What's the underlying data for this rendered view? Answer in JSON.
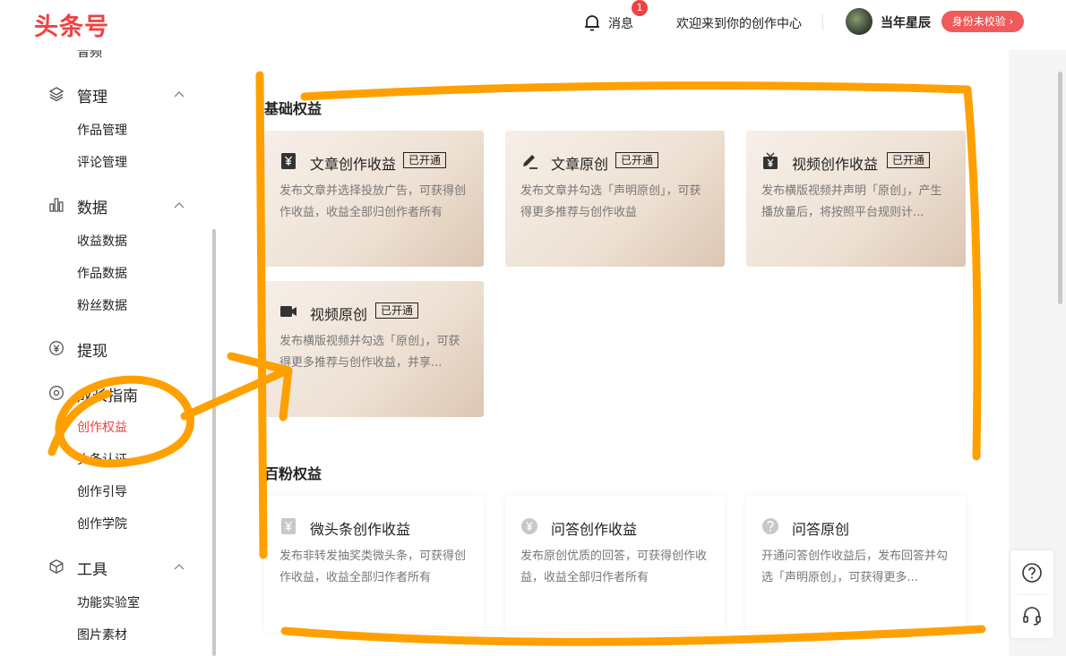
{
  "header": {
    "logo": "头条号",
    "messages_label": "消息",
    "messages_badge": "1",
    "welcome": "欢迎来到你的创作中心",
    "username": "当年星辰",
    "verify_label": "身份未校验 ›"
  },
  "sidebar": {
    "partial_top": "音频",
    "sections": [
      {
        "label": "管理",
        "icon": "layers-icon",
        "items": [
          "作品管理",
          "评论管理"
        ]
      },
      {
        "label": "数据",
        "icon": "bar-chart-icon",
        "items": [
          "收益数据",
          "作品数据",
          "粉丝数据"
        ]
      },
      {
        "label": "提现",
        "icon": "yen-circle-icon",
        "items": []
      },
      {
        "label": "成长指南",
        "icon": "compass-icon",
        "items": [
          "创作权益",
          "头条认证",
          "创作引导",
          "创作学院"
        ]
      },
      {
        "label": "工具",
        "icon": "cube-icon",
        "items": [
          "功能实验室",
          "图片素材"
        ]
      }
    ],
    "active_item": "创作权益"
  },
  "main": {
    "basic_title": "基础权益",
    "basic_cards": [
      {
        "title": "文章创作收益",
        "tag": "已开通",
        "icon": "yen-doc-icon",
        "desc": "发布文章并选择投放广告，可获得创作收益，收益全部归创作者所有"
      },
      {
        "title": "文章原创",
        "tag": "已开通",
        "icon": "pen-icon",
        "desc": "发布文章并勾选「声明原创」，可获得更多推荐与创作收益"
      },
      {
        "title": "视频创作收益",
        "tag": "已开通",
        "icon": "tv-yen-icon",
        "desc": "发布横版视频并声明「原创」，产生播放量后，将按照平台规则计..."
      },
      {
        "title": "视频原创",
        "tag": "已开通",
        "icon": "video-camera-icon",
        "desc": "发布横版视频并勾选「原创」，可获得更多推荐与创作收益，并享..."
      }
    ],
    "fans_title": "百粉权益",
    "fans_cards": [
      {
        "title": "微头条创作收益",
        "icon": "yen-doc-icon",
        "desc": "发布非转发抽奖类微头条，可获得创作收益，收益全部归作者所有"
      },
      {
        "title": "问答创作收益",
        "icon": "yen-circle-icon",
        "desc": "发布原创优质的回答，可获得创作收益，收益全部归作者所有"
      },
      {
        "title": "问答原创",
        "icon": "question-circle-icon",
        "desc": "开通问答创作收益后，发布回答并勾选「声明原创」，可获得更多..."
      }
    ]
  },
  "floating": {
    "help_icon": "question-icon",
    "service_icon": "headset-icon"
  },
  "colors": {
    "brand": "#f04142",
    "annotation": "#ffa000"
  }
}
